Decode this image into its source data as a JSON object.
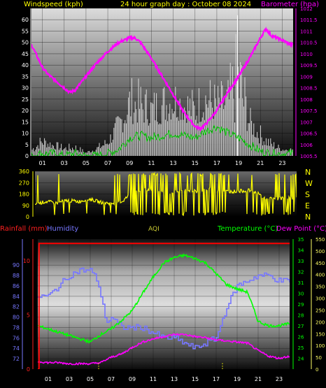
{
  "header": {
    "wind_label": "Windspeed (kph)",
    "title": "24 hour graph day : October 08 2024",
    "baro_label": "Barometer (hpa)"
  },
  "middle": {
    "compass": [
      "N",
      "W",
      "S",
      "E",
      "N"
    ]
  },
  "bottom_header": {
    "rain_label": "Rainfall (mm)",
    "hum_label": "Humidity",
    "aqi_label": "AQI",
    "temp_label": "Temperature (°C)",
    "dew_label": "Dew Point (°C)"
  },
  "colors": {
    "wind": "#ffffff",
    "wind_gust": "#d8d8d8",
    "wind_avg": "#00cc00",
    "barometer": "#ff00ff",
    "direction": "#ffff00",
    "rain": "#ff0000",
    "humidity": "#7777ff",
    "temperature": "#00ff00",
    "dewpoint": "#ff00ff",
    "aqi": "#ffff00",
    "header_text": "#ffff00"
  },
  "chart_data": [
    {
      "type": "line",
      "title": "24 hour graph day : October 08 2024",
      "x_ticks": [
        "01",
        "03",
        "05",
        "07",
        "09",
        "11",
        "13",
        "15",
        "17",
        "19",
        "21",
        "23"
      ],
      "xlim_hours": [
        0,
        24
      ],
      "y_left": {
        "label": "Windspeed (kph)",
        "ylim": [
          0,
          65
        ],
        "ticks": [
          "0",
          "5",
          "10",
          "15",
          "20",
          "25",
          "30",
          "35",
          "40",
          "45",
          "50",
          "55",
          "60"
        ]
      },
      "y_right": {
        "label": "Barometer (hpa)",
        "ylim": [
          1005.5,
          1012
        ],
        "ticks": [
          "1005.5",
          "1006",
          "1006.5",
          "1007",
          "1007.5",
          "1008",
          "1008.5",
          "1009",
          "1009.5",
          "1010",
          "1010.5",
          "1011",
          "1011.5",
          "1012"
        ]
      },
      "series": [
        {
          "name": "Barometer (hpa)",
          "axis": "right",
          "x": [
            0,
            0.5,
            1,
            1.5,
            2,
            2.5,
            3,
            3.5,
            4,
            4.5,
            5,
            6,
            7,
            8,
            9,
            9.5,
            10,
            11,
            12,
            13,
            14,
            15,
            15.5,
            16,
            17,
            18,
            19,
            20,
            21,
            21.5,
            22,
            23,
            23.8
          ],
          "y": [
            1010.4,
            1009.9,
            1009.4,
            1009.1,
            1008.9,
            1008.7,
            1008.5,
            1008.3,
            1008.4,
            1008.7,
            1009.0,
            1009.6,
            1010.1,
            1010.5,
            1010.7,
            1010.7,
            1010.5,
            1009.8,
            1009.0,
            1008.2,
            1007.4,
            1006.8,
            1006.7,
            1006.9,
            1007.5,
            1008.3,
            1009.0,
            1009.8,
            1010.7,
            1011.1,
            1010.8,
            1010.6,
            1010.4
          ]
        },
        {
          "name": "Windspeed (kph)",
          "axis": "left",
          "x": [
            0,
            1,
            2,
            3,
            4,
            5,
            6,
            7,
            8,
            9,
            10,
            11,
            12,
            13,
            14,
            15,
            16,
            17,
            18,
            19,
            20,
            21,
            22,
            23
          ],
          "y": [
            1,
            4,
            3,
            2,
            2,
            1,
            2,
            4,
            8,
            14,
            14,
            13,
            14,
            16,
            15,
            13,
            16,
            15,
            15,
            13,
            10,
            5,
            3,
            2
          ]
        },
        {
          "name": "Wind gust (kph)",
          "axis": "left",
          "x": [
            0,
            1,
            2,
            3,
            4,
            5,
            6,
            7,
            8,
            9,
            10,
            11,
            12,
            13,
            14,
            15,
            16,
            17,
            18,
            19,
            20,
            21,
            22,
            23
          ],
          "y": [
            5,
            10,
            7,
            5,
            6,
            2,
            5,
            9,
            20,
            36,
            34,
            30,
            34,
            37,
            33,
            30,
            38,
            33,
            35,
            62,
            22,
            14,
            8,
            4
          ]
        },
        {
          "name": "Average wind (kph)",
          "axis": "left",
          "x": [
            0,
            1,
            2,
            3,
            4,
            5,
            6,
            7,
            8,
            9,
            10,
            11,
            12,
            13,
            14,
            15,
            16,
            17,
            18,
            19,
            20,
            21,
            22,
            23
          ],
          "y": [
            0,
            1,
            1,
            0,
            1,
            0,
            0,
            1,
            3,
            8,
            9,
            8,
            9,
            10,
            9,
            8,
            11,
            13,
            10,
            8,
            5,
            2,
            1,
            1
          ]
        }
      ]
    },
    {
      "type": "line",
      "title": "",
      "x_ticks": [],
      "ylim": [
        0,
        360
      ],
      "y_ticks": [
        "0",
        "90",
        "180",
        "270",
        "360"
      ],
      "right_labels": [
        "N",
        "W",
        "S",
        "E",
        "N"
      ],
      "series": [
        {
          "name": "Wind direction (deg)",
          "x": [
            0,
            1,
            2,
            3,
            4,
            5,
            6,
            7,
            8,
            9,
            10,
            11,
            12,
            13,
            14,
            15,
            16,
            17,
            18,
            19,
            20,
            21,
            22,
            23
          ],
          "y": [
            100,
            120,
            110,
            130,
            120,
            140,
            115,
            105,
            120,
            200,
            220,
            210,
            190,
            200,
            210,
            200,
            220,
            200,
            200,
            205,
            210,
            150,
            140,
            150
          ]
        }
      ]
    },
    {
      "type": "line",
      "title": "",
      "x_ticks": [
        "01",
        "03",
        "05",
        "07",
        "09",
        "11",
        "13",
        "15",
        "17",
        "19",
        "21",
        "23"
      ],
      "xlim_hours": [
        0,
        24
      ],
      "axes": {
        "rainfall": {
          "label": "Rainfall (mm)",
          "ylim": [
            0,
            12
          ],
          "ticks": [
            "0",
            "5",
            "10"
          ]
        },
        "humidity": {
          "label": "Humidity",
          "ylim": [
            70,
            95
          ],
          "ticks": [
            "72",
            "74",
            "76",
            "78",
            "80",
            "82",
            "84",
            "86",
            "88",
            "90"
          ]
        },
        "temperature": {
          "label": "Temperature (°C)",
          "ylim": [
            23,
            35
          ],
          "ticks": [
            "24",
            "25",
            "26",
            "27",
            "28",
            "29",
            "30",
            "31",
            "32",
            "33",
            "34",
            "35"
          ]
        },
        "aqi": {
          "label": "AQI",
          "ylim": [
            0,
            550
          ],
          "ticks": [
            "0",
            "50",
            "100",
            "150",
            "200",
            "250",
            "300",
            "350",
            "400",
            "450",
            "500",
            "550"
          ]
        }
      },
      "series": [
        {
          "name": "Rainfall (mm)",
          "axis": "rainfall",
          "x": [
            0.0,
            0.12,
            0.12,
            24
          ],
          "y": [
            0,
            0,
            11.6,
            11.6
          ]
        },
        {
          "name": "Humidity",
          "axis": "humidity",
          "x": [
            0,
            1,
            2,
            3,
            4,
            5,
            5.7,
            6,
            6.3,
            6.6,
            7,
            8,
            9,
            10,
            11,
            12,
            13,
            14,
            15,
            16,
            17,
            18,
            19,
            20,
            21,
            22,
            23,
            24
          ],
          "y": [
            84,
            84,
            86,
            88,
            89,
            89,
            87,
            84,
            81,
            79,
            80,
            78,
            78,
            78,
            77,
            76,
            76,
            75,
            74,
            75,
            76,
            82,
            86,
            87,
            88,
            88,
            87,
            87
          ]
        },
        {
          "name": "Temperature (°C)",
          "axis": "temperature",
          "x": [
            0,
            1,
            2,
            3,
            4,
            5,
            6,
            7,
            8,
            9,
            10,
            11,
            12,
            13,
            14,
            15,
            16,
            17,
            18,
            19,
            20,
            21,
            22,
            23,
            24
          ],
          "y": [
            27.0,
            26.7,
            26.4,
            26.1,
            25.8,
            25.5,
            26.2,
            26.7,
            27.5,
            28.4,
            30.0,
            31.5,
            32.8,
            33.3,
            33.5,
            33.2,
            32.8,
            31.8,
            30.8,
            30.4,
            30.1,
            27.4,
            27.0,
            27.0,
            27.2
          ]
        },
        {
          "name": "Dew Point (°C)",
          "axis": "temperature",
          "x": [
            0,
            1,
            2,
            3,
            4,
            5,
            6,
            7,
            8,
            9,
            10,
            11,
            12,
            13,
            14,
            15,
            16,
            17,
            18,
            19,
            20,
            21,
            22,
            23,
            24
          ],
          "y": [
            23.7,
            23.6,
            23.6,
            23.5,
            23.5,
            23.5,
            23.6,
            24.1,
            24.4,
            25.0,
            25.5,
            25.8,
            26.0,
            26.2,
            26.2,
            26.0,
            25.9,
            25.7,
            25.6,
            25.5,
            25.4,
            24.7,
            24.2,
            24.0,
            24.2
          ]
        },
        {
          "name": "AQI",
          "axis": "aqi",
          "x": [
            5.8,
            5.8,
            17.6,
            17.6
          ],
          "y": [
            0,
            30,
            0,
            30
          ]
        }
      ]
    }
  ]
}
